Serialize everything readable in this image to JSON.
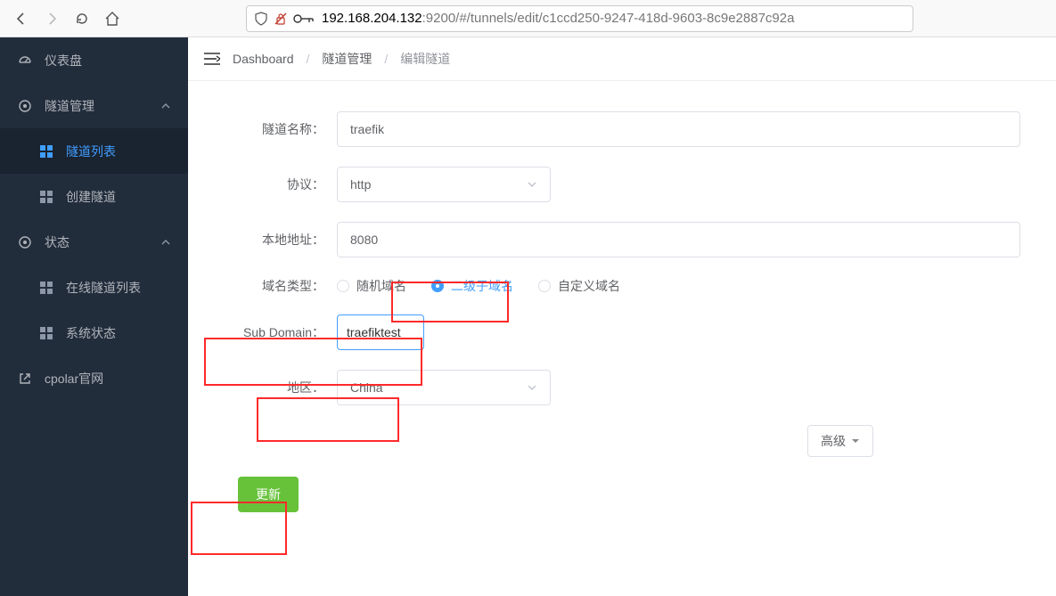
{
  "browser": {
    "url_ip": "192.168.204.132",
    "url_rest": ":9200/#/tunnels/edit/c1ccd250-9247-418d-9603-8c9e2887c92a"
  },
  "sidebar": {
    "dashboard": "仪表盘",
    "tunnel_mgmt": "隧道管理",
    "tunnel_list": "隧道列表",
    "create_tunnel": "创建隧道",
    "status": "状态",
    "online_tunnels": "在线隧道列表",
    "system_status": "系统状态",
    "cpolar_site": "cpolar官网"
  },
  "breadcrumb": {
    "dashboard": "Dashboard",
    "tunnel_mgmt": "隧道管理",
    "edit_tunnel": "编辑隧道"
  },
  "form": {
    "tunnel_name_label": "隧道名称：",
    "tunnel_name_value": "traefik",
    "proto_label": "协议：",
    "proto_value": "http",
    "local_addr_label": "本地地址：",
    "local_addr_value": "8080",
    "domain_type_label": "域名类型：",
    "domain_type_random": "随机域名",
    "domain_type_sub": "二级子域名",
    "domain_type_custom": "自定义域名",
    "subdomain_label": "Sub Domain：",
    "subdomain_value": "traefiktest",
    "region_label": "地区：",
    "region_value": "China",
    "advanced": "高级",
    "submit": "更新"
  }
}
